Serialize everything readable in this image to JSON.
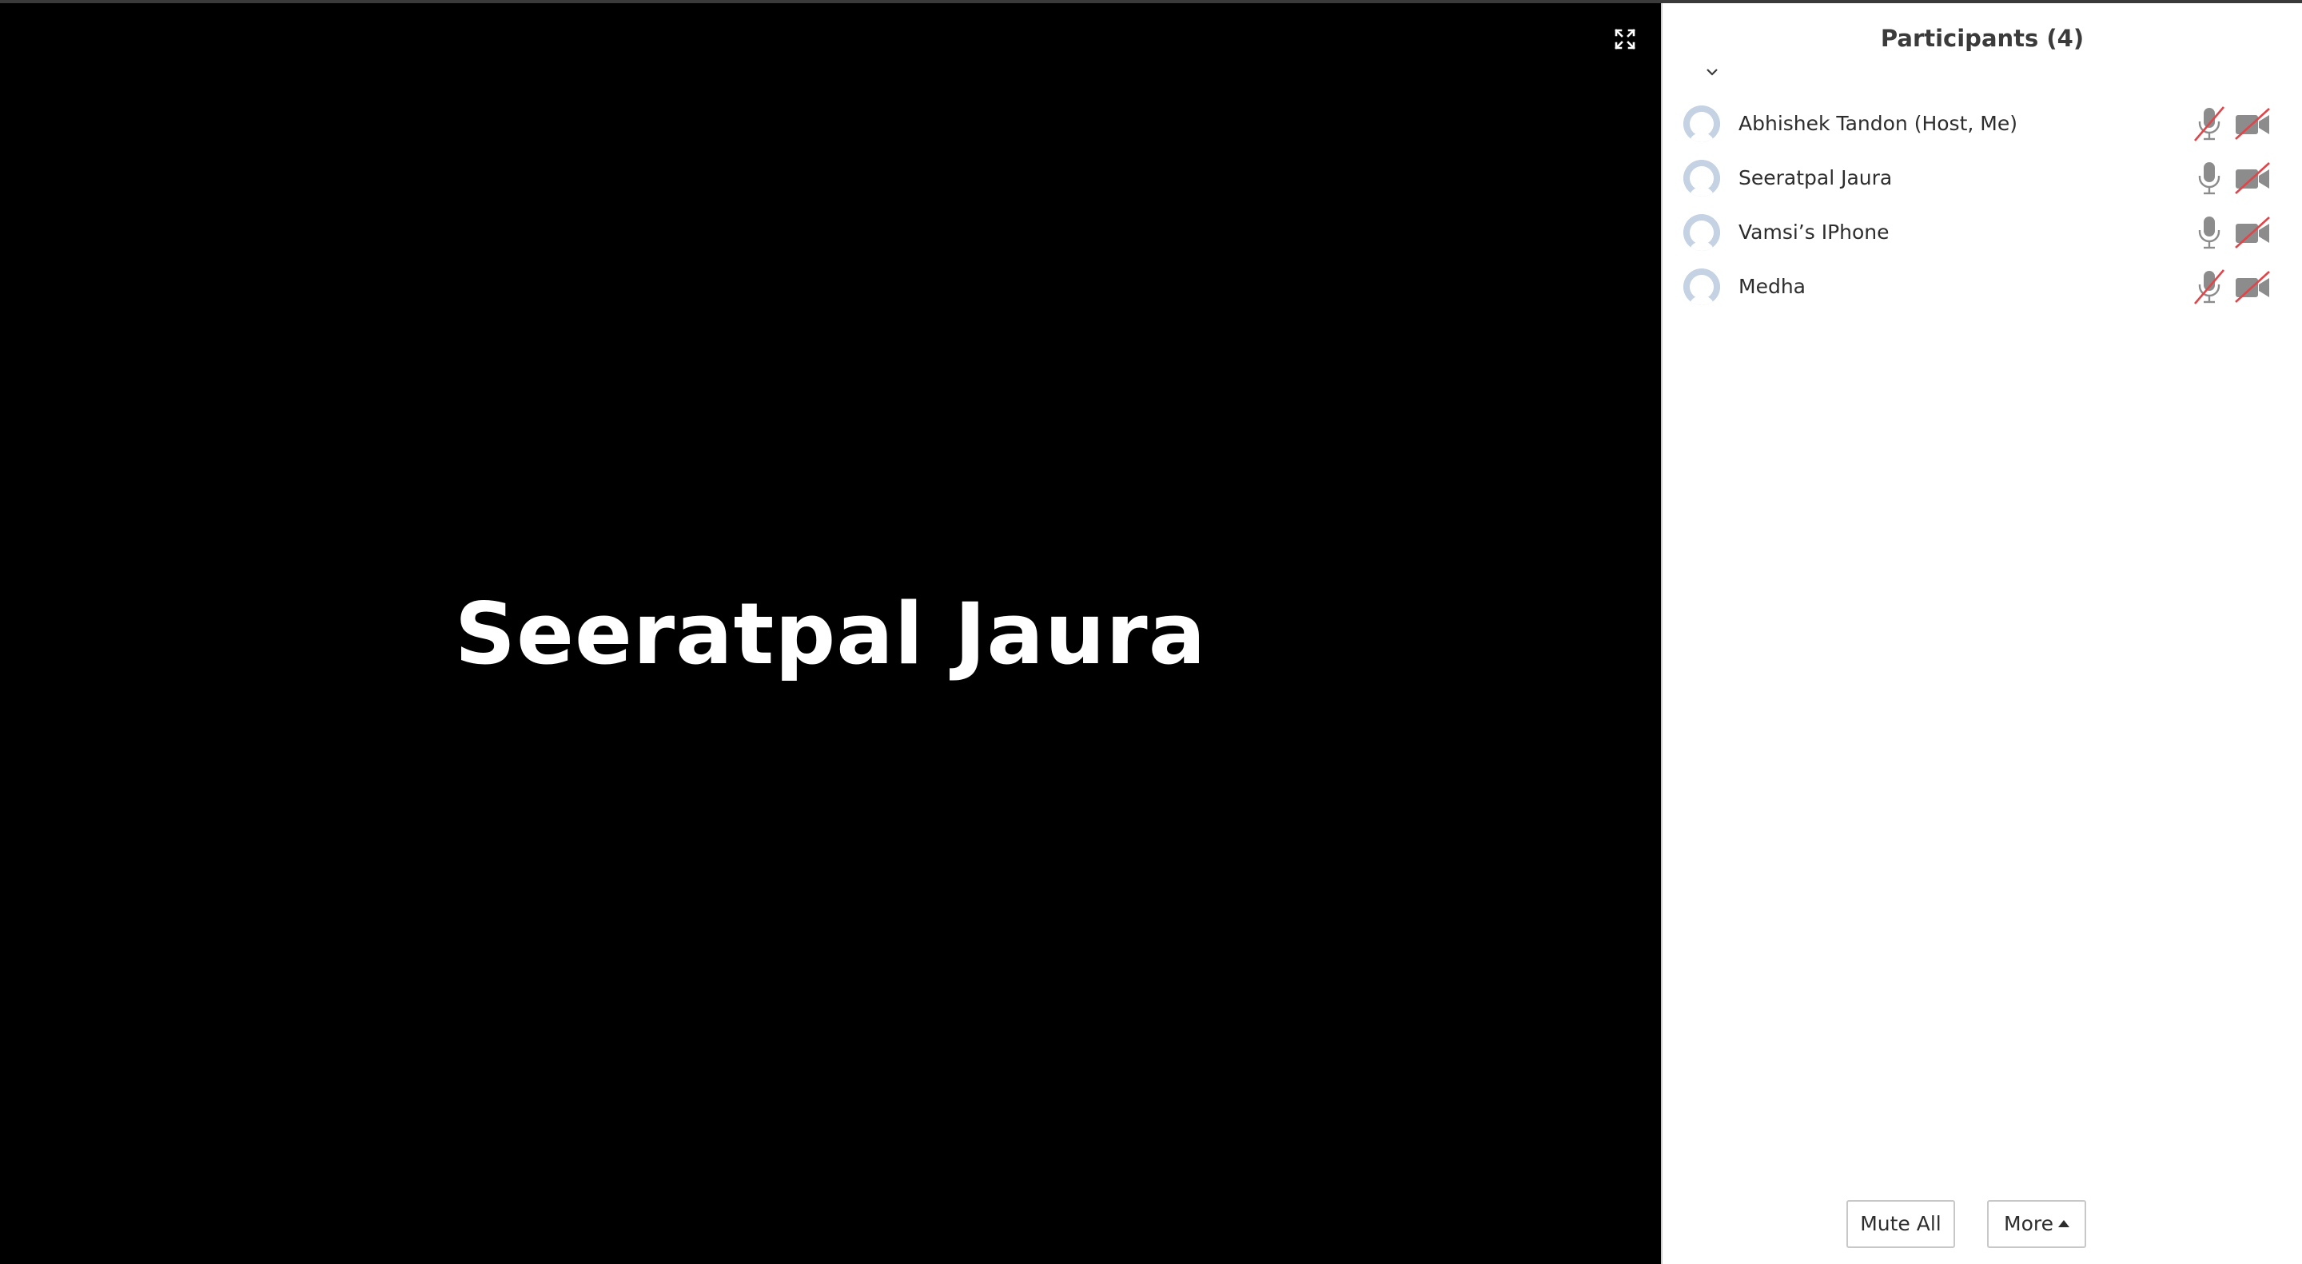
{
  "speaker": {
    "name": "Seeratpal Jaura"
  },
  "panel": {
    "title": "Participants (4)"
  },
  "participants": [
    {
      "name": "Abhishek Tandon (Host, Me)",
      "mic": "muted",
      "video": "off"
    },
    {
      "name": "Seeratpal Jaura",
      "mic": "on",
      "video": "off"
    },
    {
      "name": "Vamsi’s IPhone",
      "mic": "on",
      "video": "off"
    },
    {
      "name": "Medha",
      "mic": "muted",
      "video": "off"
    }
  ],
  "footer": {
    "mute_all_label": "Mute All",
    "more_label": "More"
  },
  "icons": {
    "fullscreen": "fullscreen-icon",
    "collapse": "chevron-down-icon",
    "avatar": "avatar-icon",
    "mic_on": "microphone-icon",
    "mic_muted": "microphone-muted-icon",
    "video_off": "video-off-icon",
    "more_caret": "caret-up-icon"
  },
  "colors": {
    "video_background": "#000000",
    "panel_background": "#ffffff",
    "icon_gray": "#8c8c8c",
    "muted_slash": "#e0454a",
    "avatar_fill": "#c4d2e3"
  }
}
